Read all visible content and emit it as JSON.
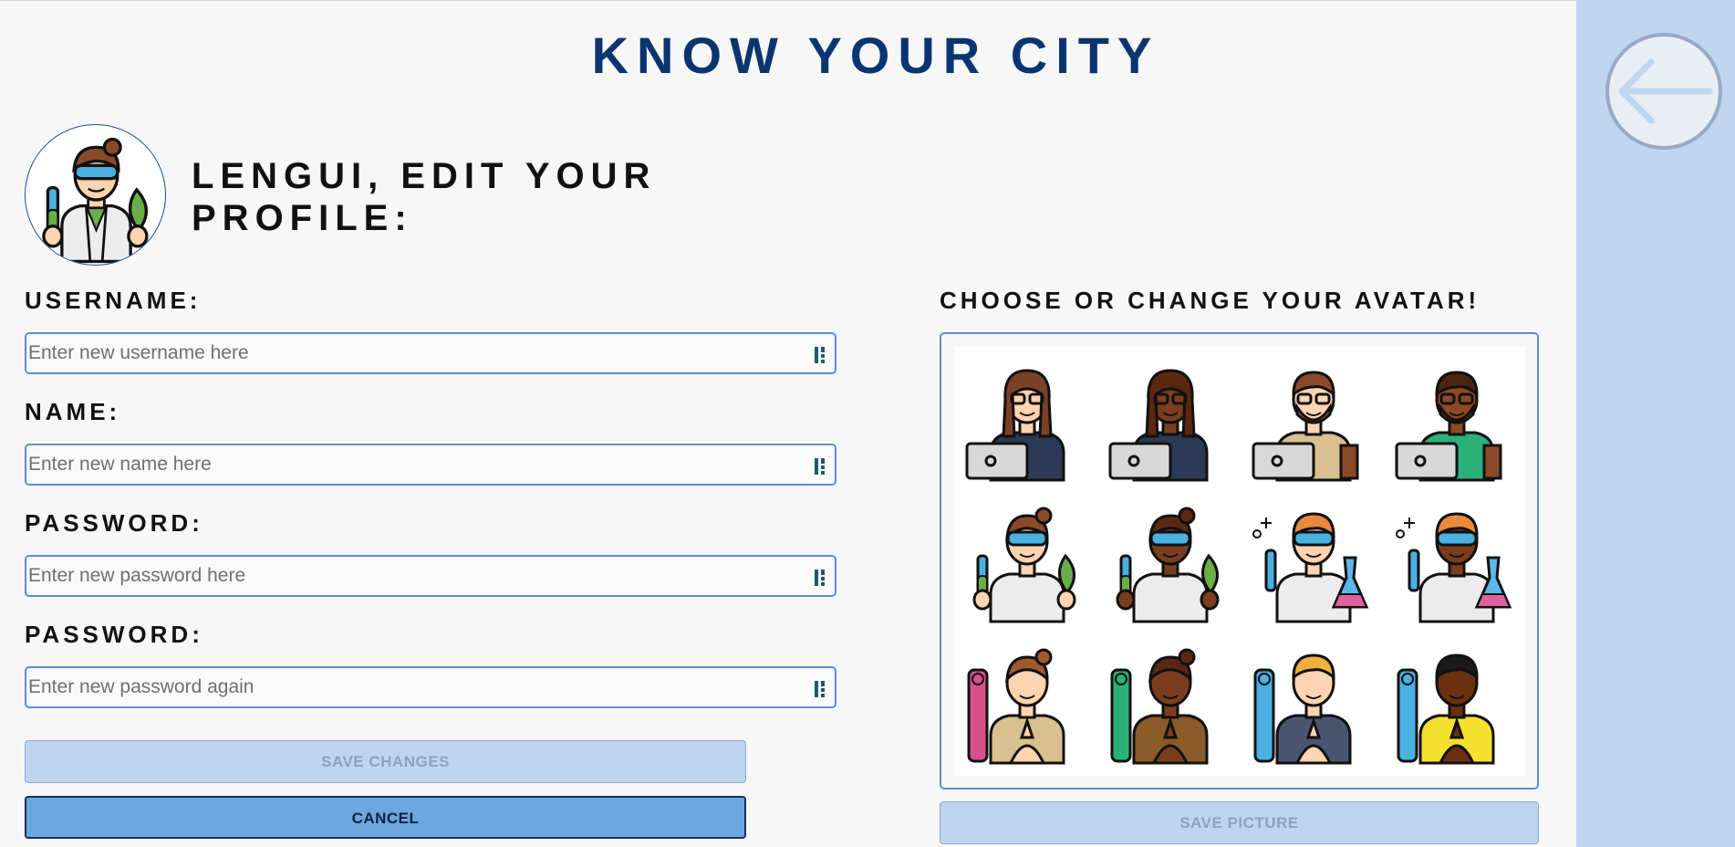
{
  "app": {
    "title": "KNOW YOUR CITY"
  },
  "profile": {
    "heading": "LENGUI, EDIT YOUR PROFILE:",
    "current_avatar": "scientist-woman-light-avatar"
  },
  "form": {
    "username": {
      "label": "USERNAME:",
      "placeholder": "Enter new username here",
      "value": ""
    },
    "name": {
      "label": "NAME:",
      "placeholder": "Enter new name here",
      "value": ""
    },
    "password": {
      "label": "PASSWORD:",
      "placeholder": "Enter new password here",
      "value": ""
    },
    "password_confirm": {
      "label": "PASSWORD:",
      "placeholder": "Enter new password again",
      "value": ""
    },
    "input_icon": "password-manager-key-icon",
    "save_label": "SAVE CHANGES",
    "cancel_label": "CANCEL"
  },
  "avatar_picker": {
    "heading": "CHOOSE OR CHANGE YOUR AVATAR!",
    "save_label": "SAVE PICTURE",
    "avatars": [
      {
        "name": "developer-woman-light",
        "skin": "#ffd4b0",
        "hair": "#7a4028",
        "shirt": "#2b3a55",
        "kind": "developer",
        "gender": "f"
      },
      {
        "name": "developer-woman-dark",
        "skin": "#7a3e1e",
        "hair": "#5a2810",
        "shirt": "#2b3a55",
        "kind": "developer",
        "gender": "f"
      },
      {
        "name": "developer-man-light",
        "skin": "#ffd4b0",
        "hair": "#8a4a28",
        "shirt": "#d9c090",
        "kind": "developer",
        "gender": "m"
      },
      {
        "name": "developer-man-dark",
        "skin": "#8b4a22",
        "hair": "#4a2410",
        "shirt": "#2bb07a",
        "kind": "developer",
        "gender": "m"
      },
      {
        "name": "scientist-woman-light",
        "skin": "#ffd4b0",
        "hair": "#8a4a28",
        "shirt": "#ececec",
        "kind": "scientist",
        "gender": "f"
      },
      {
        "name": "scientist-woman-dark",
        "skin": "#7a3e1e",
        "hair": "#5a2810",
        "shirt": "#ececec",
        "kind": "scientist",
        "gender": "f"
      },
      {
        "name": "scientist-man-light",
        "skin": "#ffd4b0",
        "hair": "#e88a3a",
        "shirt": "#ececec",
        "kind": "chemist",
        "gender": "m"
      },
      {
        "name": "scientist-man-dark",
        "skin": "#7a3e1e",
        "hair": "#e88a3a",
        "shirt": "#ececec",
        "kind": "chemist",
        "gender": "m"
      },
      {
        "name": "yoga-woman-light",
        "skin": "#ffd4b0",
        "hair": "#a0582e",
        "shirt": "#d8c090",
        "kind": "yoga",
        "gender": "f"
      },
      {
        "name": "yoga-woman-dark",
        "skin": "#7a3e1e",
        "hair": "#5a2810",
        "shirt": "#8a5a28",
        "kind": "yoga",
        "gender": "f"
      },
      {
        "name": "yoga-man-light",
        "skin": "#ffd4b0",
        "hair": "#f0b040",
        "shirt": "#4a5570",
        "kind": "yoga",
        "gender": "m"
      },
      {
        "name": "yoga-man-dark",
        "skin": "#6a3010",
        "hair": "#1a1a1a",
        "shirt": "#f5e030",
        "kind": "yoga",
        "gender": "m"
      }
    ]
  },
  "navigation": {
    "back_icon": "arrow-left-icon"
  },
  "colors": {
    "title": "#0b3570",
    "accent": "#6ea6e0",
    "input_border": "#5b8fd0",
    "side_panel": "#bfd6f0",
    "disabled_button": "#bfd4ee"
  }
}
